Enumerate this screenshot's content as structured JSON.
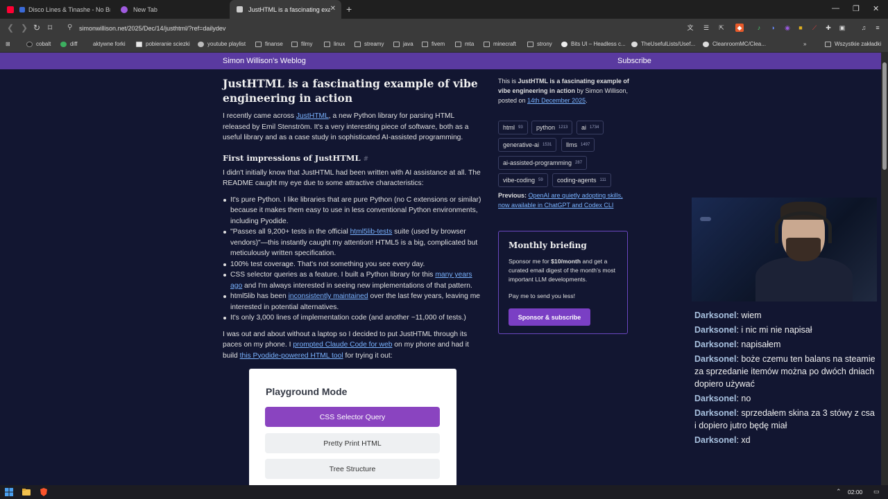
{
  "browser": {
    "tabs": [
      {
        "label": "Disco Lines & Tinashe - No Broke",
        "icon": "youtube-icon",
        "color": "#ff0033"
      },
      {
        "label": "New Tab",
        "icon": "proton-icon",
        "color": "#a05be0"
      },
      {
        "label": "JustHTML is a fascinating examp",
        "icon": "page-icon",
        "color": "#cccccc"
      }
    ],
    "url": "simonwillison.net/2025/Dec/14/justhtml/?ref=dailydev",
    "bookmarks": [
      {
        "label": "cobalt",
        "icon": "cobalt-icon"
      },
      {
        "label": "diff",
        "icon": "diff-icon"
      },
      {
        "label": "aktywne forki",
        "icon": "fork-icon"
      },
      {
        "label": "pobieranie sciezki",
        "icon": "download-icon"
      },
      {
        "label": "youtube playlist",
        "icon": "globe-icon"
      },
      {
        "label": "finanse",
        "icon": "folder-icon"
      },
      {
        "label": "filmy",
        "icon": "folder-icon"
      },
      {
        "label": "linux",
        "icon": "folder-icon"
      },
      {
        "label": "streamy",
        "icon": "folder-icon"
      },
      {
        "label": "java",
        "icon": "folder-icon"
      },
      {
        "label": "fivem",
        "icon": "folder-icon"
      },
      {
        "label": "mta",
        "icon": "folder-icon"
      },
      {
        "label": "minecraft",
        "icon": "folder-icon"
      },
      {
        "label": "strony",
        "icon": "folder-icon"
      },
      {
        "label": "Bits UI – Headless c...",
        "icon": "bits-icon"
      },
      {
        "label": "TheUsefulLists/Usef...",
        "icon": "github-icon"
      },
      {
        "label": "CleanroomMC/Clea...",
        "icon": "github-icon"
      },
      {
        "label": "Wszystkie zakładki",
        "icon": "folder-icon"
      }
    ]
  },
  "site": {
    "title": "Simon Willison's Weblog",
    "subscribe": "Subscribe"
  },
  "article": {
    "title": "JustHTML is a fascinating example of vibe engineering in action",
    "intro": {
      "t1": "I recently came across ",
      "link": "JustHTML",
      "t2": ", a new Python library for parsing HTML released by Emil Stenström. It's a very interesting piece of software, both as a useful library and as a case study in sophisticated AI-assisted programming."
    },
    "h_first": "First impressions of JustHTML",
    "h_hash": "#",
    "p2": "I didn't initially know that JustHTML had been written with AI assistance at all. The README caught my eye due to some attractive characteristics:",
    "bullets": {
      "b1": "It's pure Python. I like libraries that are pure Python (no C extensions or similar) because it makes them easy to use in less conventional Python environments, including Pyodide.",
      "b2_t1": "\"Passes all 9,200+ tests in the official ",
      "b2_link": "html5lib-tests",
      "b2_t2": " suite (used by browser vendors)\"—this instantly caught my attention! HTML5 is a big, complicated but meticulously written specification.",
      "b3": "100% test coverage. That's not something you see every day.",
      "b4_t1": "CSS selector queries as a feature. I built a Python library for this ",
      "b4_link": "many years ago",
      "b4_t2": " and I'm always interested in seeing new implementations of that pattern.",
      "b5_t1": "html5lib has been ",
      "b5_link": "inconsistently maintained",
      "b5_t2": " over the last few years, leaving me interested in potential alternatives.",
      "b6": "It's only 3,000 lines of implementation code (and another ~11,000 of tests.)"
    },
    "p3": {
      "t1": "I was out and about without a laptop so I decided to put JustHTML through its paces on my phone. I ",
      "link1": "prompted Claude Code for web",
      "t2": " on my phone and had it build ",
      "link2": "this Pyodide-powered HTML tool",
      "t3": " for trying it out:"
    },
    "playground": {
      "title": "Playground Mode",
      "btn1": "CSS Selector Query",
      "btn2": "Pretty Print HTML",
      "btn3": "Tree Structure"
    }
  },
  "sidebar": {
    "intro_t1": "This is ",
    "intro_bold": "JustHTML is a fascinating example of vibe engineering in action",
    "intro_t2": " by Simon Willison, posted on ",
    "intro_date": "14th December 2025",
    "intro_t3": ".",
    "tags": [
      {
        "name": "html",
        "count": "93"
      },
      {
        "name": "python",
        "count": "1213"
      },
      {
        "name": "ai",
        "count": "1734"
      },
      {
        "name": "generative-ai",
        "count": "1531"
      },
      {
        "name": "llms",
        "count": "1497"
      },
      {
        "name": "ai-assisted-programming",
        "count": "287"
      },
      {
        "name": "vibe-coding",
        "count": "59"
      },
      {
        "name": "coding-agents",
        "count": "111"
      }
    ],
    "prev_label": "Previous:",
    "prev_link": "OpenAI are quietly adopting skills, now available in ChatGPT and Codex CLI",
    "briefing": {
      "title": "Monthly briefing",
      "t1": "Sponsor me for ",
      "bold": "$10/month",
      "t2": " and get a curated email digest of the month's most important LLM developments.",
      "pay": "Pay me to send you less!",
      "button": "Sponsor & subscribe"
    }
  },
  "chat": [
    {
      "user": "Darksonel",
      "text": ": wiem"
    },
    {
      "user": "Darksonel",
      "text": ": i nic mi nie napisał"
    },
    {
      "user": "Darksonel",
      "text": ": napisałem"
    },
    {
      "user": "Darksonel",
      "text": ": boże czemu ten balans na steamie za sprzedanie itemów można po dwóch dniach dopiero używać"
    },
    {
      "user": "Darksonel",
      "text": ": no"
    },
    {
      "user": "Darksonel",
      "text": ": sprzedałem skina za 3 stówy z csa i dopiero jutro będę miał"
    },
    {
      "user": "Darksonel",
      "text": ": xd"
    }
  ],
  "taskbar": {
    "clock": "02:00"
  },
  "colors": {
    "page_bg": "#121631",
    "header_purple": "#5a3aa0",
    "link": "#7ab3ff",
    "button_purple": "#7a3fc4",
    "playground_purple": "#8a44c0"
  }
}
